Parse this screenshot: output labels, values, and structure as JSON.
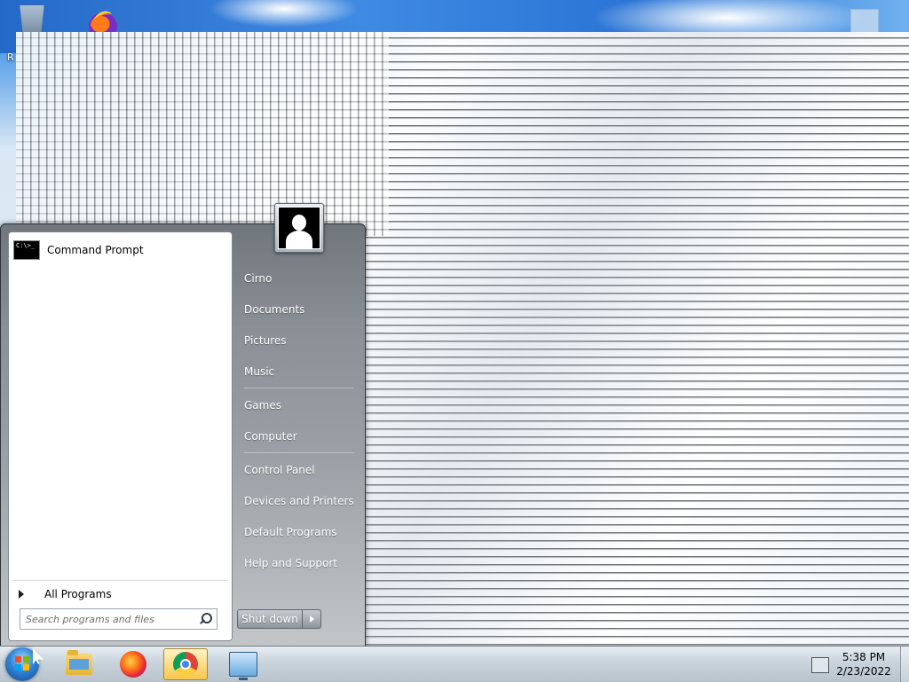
{
  "desktop": {
    "icons": [
      {
        "name": "recycle-bin-icon"
      },
      {
        "name": "firefox-icon"
      },
      {
        "name": "file-icon"
      }
    ],
    "partial_label": "R"
  },
  "start_menu": {
    "pinned_programs": [
      {
        "label": "Command Prompt",
        "icon": "command-prompt-icon",
        "icon_text": "C:\\>_"
      }
    ],
    "all_programs_label": "All Programs",
    "search": {
      "placeholder": "Search programs and files"
    },
    "user_tile_icon": "user-avatar-icon",
    "right_links": [
      {
        "label": "Cirno"
      },
      {
        "label": "Documents"
      },
      {
        "label": "Pictures"
      },
      {
        "label": "Music"
      },
      {
        "label": "Games"
      },
      {
        "label": "Computer"
      },
      {
        "label": "Control Panel"
      },
      {
        "label": "Devices and Printers"
      },
      {
        "label": "Default Programs"
      },
      {
        "label": "Help and Support"
      }
    ],
    "shutdown_label": "Shut down"
  },
  "taskbar": {
    "buttons": [
      {
        "name": "windows-explorer",
        "icon": "folder-icon"
      },
      {
        "name": "firefox",
        "icon": "firefox-icon"
      },
      {
        "name": "google-chrome",
        "icon": "chrome-icon",
        "active": true
      },
      {
        "name": "remote-desktop",
        "icon": "remote-desktop-icon"
      }
    ],
    "tray_icon": "network-icon",
    "clock": {
      "time": "5:38 PM",
      "date": "2/23/2022"
    }
  }
}
